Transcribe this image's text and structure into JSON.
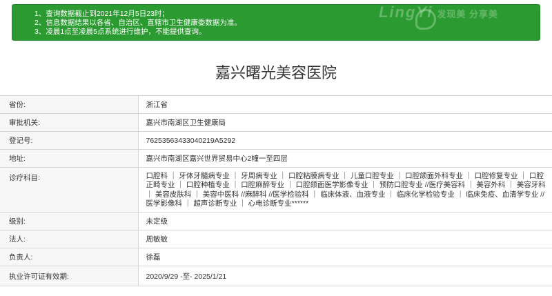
{
  "notice": {
    "lines": [
      "1、查询数据截止到2021年12月5日23时；",
      "2、信息数据结果以各省、自治区、直辖市卫生健康委数据为准。",
      "3、凌晨1点至凌晨5点系统进行维护，不能提供查询。"
    ],
    "watermark": "LingYi",
    "watermark_sub": "发现美 分享美"
  },
  "hospital_name": "嘉兴曙光美容医院",
  "fields": [
    {
      "label": "省份:",
      "value": "浙江省"
    },
    {
      "label": "审批机关:",
      "value": "嘉兴市南湖区卫生健康局"
    },
    {
      "label": "登记号:",
      "value": "76253563433040219A5292"
    },
    {
      "label": "地址:",
      "value": "嘉兴市南湖区嘉兴世界贸易中心2幢一至四层"
    },
    {
      "label": "诊疗科目:",
      "value": "口腔科 ｜ 牙体牙髓病专业 ｜ 牙周病专业 ｜ 口腔粘膜病专业 ｜ 儿童口腔专业 ｜ 口腔颌面外科专业 ｜ 口腔修复专业 ｜ 口腔正畸专业 ｜ 口腔种植专业 ｜ 口腔麻醉专业 ｜ 口腔颌面医学影像专业 ｜ 预防口腔专业 //医疗美容科 ｜ 美容外科 ｜ 美容牙科 ｜ 美容皮肤科 ｜ 美容中医科 //麻醉科 //医学检验科 ｜ 临床体液、血液专业 ｜ 临床化学检验专业 ｜ 临床免疫、血清学专业 //医学影像科 ｜ 超声诊断专业 ｜ 心电诊断专业******"
    },
    {
      "label": "级别:",
      "value": "未定级"
    },
    {
      "label": "法人:",
      "value": "周敏敏"
    },
    {
      "label": "负责人:",
      "value": "徐磊"
    },
    {
      "label": "执业许可证有效期:",
      "value": "2020/9/29 -至- 2025/1/21"
    }
  ]
}
